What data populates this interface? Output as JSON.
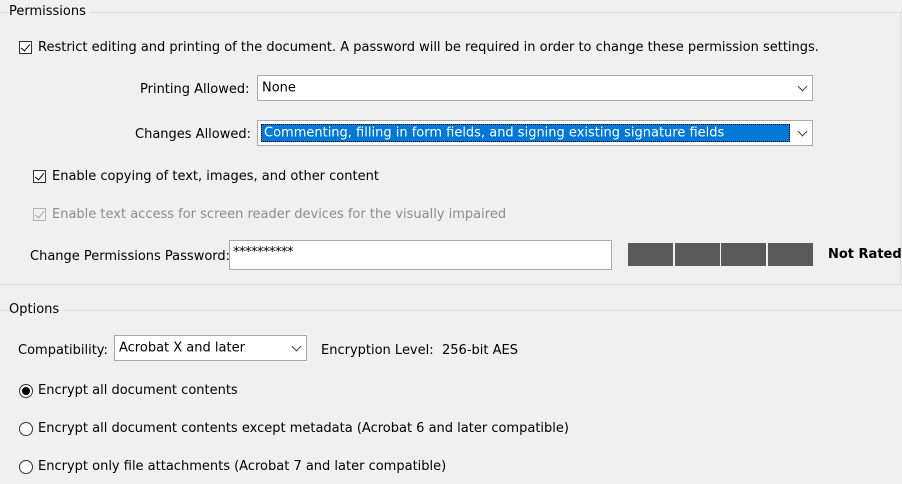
{
  "permissions": {
    "title": "Permissions",
    "restrict_label": "Restrict editing and printing of the document. A password will be required in order to change these permission settings.",
    "restrict_checked": true,
    "printing_label": "Printing Allowed:",
    "printing_value": "None",
    "changes_label": "Changes Allowed:",
    "changes_value": "Commenting, filling in form fields, and signing existing signature fields",
    "copy_label": "Enable copying of text, images, and other content",
    "copy_checked": true,
    "screenreader_label": "Enable text access for screen reader devices for the visually impaired",
    "screenreader_checked": true,
    "screenreader_disabled": true,
    "password_label": "Change Permissions Password:",
    "password_value": "**********",
    "strength_text": "Not Rated",
    "strength_segments": 4
  },
  "options": {
    "title": "Options",
    "compatibility_label": "Compatibility:",
    "compatibility_value": "Acrobat X and later",
    "encryption_label": "Encryption  Level:",
    "encryption_value": "256-bit AES",
    "radios": [
      {
        "label": "Encrypt all document contents",
        "checked": true
      },
      {
        "label": "Encrypt all document contents except metadata (Acrobat 6 and later compatible)",
        "checked": false
      },
      {
        "label": "Encrypt only file attachments (Acrobat 7 and later compatible)",
        "checked": false
      }
    ]
  },
  "colors": {
    "selection": "#0078d7",
    "meter": "#5a5a5a",
    "background": "#f0f0f0"
  }
}
